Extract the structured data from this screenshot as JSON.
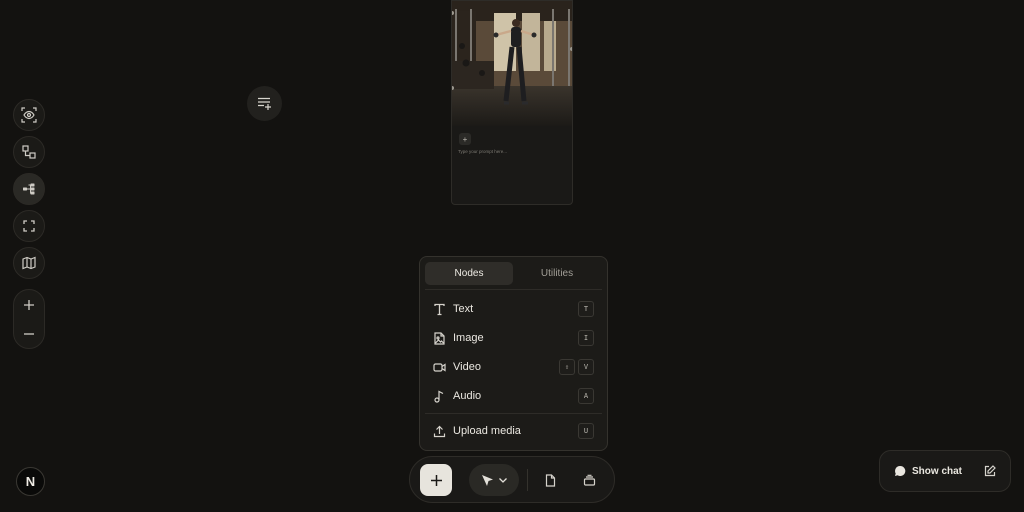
{
  "canvas_node": {
    "prompt_placeholder": "Type your prompt here...",
    "add_label": "+"
  },
  "add_menu": {
    "tabs": [
      {
        "label": "Nodes",
        "active": true
      },
      {
        "label": "Utilities",
        "active": false
      }
    ],
    "items": [
      {
        "label": "Text",
        "icon": "text-icon",
        "shortcut": [
          "T"
        ]
      },
      {
        "label": "Image",
        "icon": "image-icon",
        "shortcut": [
          "I"
        ]
      },
      {
        "label": "Video",
        "icon": "video-icon",
        "shortcut": [
          "⇧",
          "V"
        ]
      },
      {
        "label": "Audio",
        "icon": "audio-icon",
        "shortcut": [
          "A"
        ]
      }
    ],
    "upload": {
      "label": "Upload media",
      "icon": "upload-icon",
      "shortcut": [
        "U"
      ]
    }
  },
  "left_toolbar": {
    "icons": [
      "preview-icon",
      "layout-icon",
      "workflow-icon",
      "fit-view-icon",
      "minimap-icon"
    ],
    "zoom_in": "+",
    "zoom_out": "−"
  },
  "show_chat": {
    "label": "Show chat"
  },
  "logo": {
    "letter": "N"
  },
  "colors": {
    "background": "#131210",
    "panel": "#1c1b18",
    "accent_button": "#e7e4dd"
  }
}
